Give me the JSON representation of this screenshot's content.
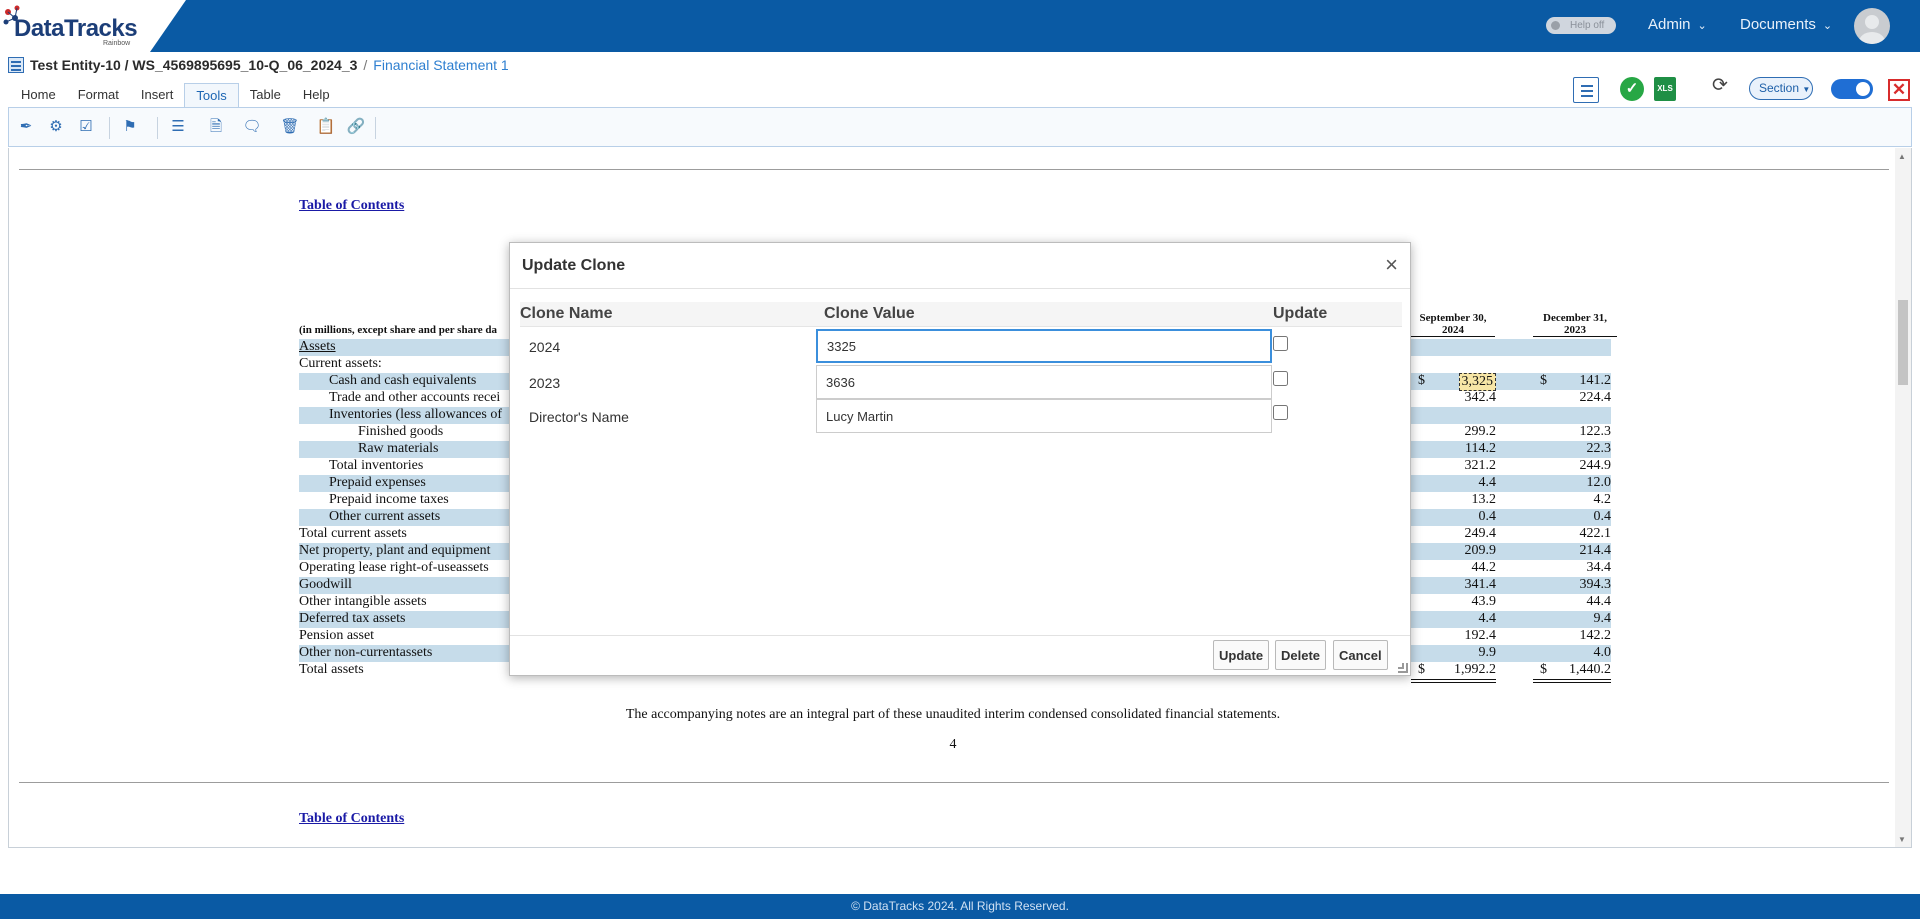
{
  "brand": {
    "logo_main": "DataTracks",
    "logo_sub": "Rainbow"
  },
  "header": {
    "help_toggle": "Help off",
    "admin_label": "Admin",
    "documents_label": "Documents"
  },
  "breadcrumb": {
    "entity_path": "Test Entity-10 / WS_4569895695_10-Q_06_2024_3",
    "separator": "/",
    "current": "Financial Statement 1"
  },
  "menu": {
    "items": [
      "Home",
      "Format",
      "Insert",
      "Tools",
      "Table",
      "Help"
    ],
    "active": "Tools"
  },
  "right_tools": {
    "section_label": "Section"
  },
  "document": {
    "toc_label": "Table of Contents",
    "unit_note": "(in millions, except share and per share da",
    "col1_header_line1": "September 30,",
    "col1_header_line2": "2024",
    "col2_header_line1": "December 31,",
    "col2_header_line2": "2023",
    "rows": [
      {
        "label": "Assets",
        "v1": "",
        "v2": ""
      },
      {
        "label": "Current assets:",
        "v1": "",
        "v2": ""
      },
      {
        "label": "Cash and cash equivalents",
        "v1": "3,325",
        "v2": "141.2"
      },
      {
        "label": "Trade and other accounts recei",
        "v1": "342.4",
        "v2": "224.4"
      },
      {
        "label": "Inventories (less allowances of",
        "v1": "",
        "v2": ""
      },
      {
        "label": "Finished goods",
        "v1": "299.2",
        "v2": "122.3"
      },
      {
        "label": "Raw materials",
        "v1": "114.2",
        "v2": "22.3"
      },
      {
        "label": "Total inventories",
        "v1": "321.2",
        "v2": "244.9"
      },
      {
        "label": "Prepaid expenses",
        "v1": "4.4",
        "v2": "12.0"
      },
      {
        "label": "Prepaid income taxes",
        "v1": "13.2",
        "v2": "4.2"
      },
      {
        "label": "Other current assets",
        "v1": "0.4",
        "v2": "0.4"
      },
      {
        "label": "Total current assets",
        "v1": "249.4",
        "v2": "422.1"
      },
      {
        "label": "Net property, plant and equipment",
        "v1": "209.9",
        "v2": "214.4"
      },
      {
        "label": "Operating lease right-of-useassets",
        "v1": "44.2",
        "v2": "34.4"
      },
      {
        "label": "Goodwill",
        "v1": "341.4",
        "v2": "394.3"
      },
      {
        "label": "Other intangible assets",
        "v1": "43.9",
        "v2": "44.4"
      },
      {
        "label": "Deferred tax assets",
        "v1": "4.4",
        "v2": "9.4"
      },
      {
        "label": "Pension asset",
        "v1": "192.4",
        "v2": "142.2"
      },
      {
        "label": "Other non-currentassets",
        "v1": "9.9",
        "v2": "4.0"
      },
      {
        "label": "Total assets",
        "v1": "1,992.2",
        "v2": "1,440.2"
      }
    ],
    "currency_symbol": "$",
    "footnote": "The accompanying notes are an integral part of these unaudited interim condensed consolidated financial statements.",
    "page_number": "4"
  },
  "modal": {
    "title": "Update Clone",
    "close_symbol": "×",
    "col_name": "Clone Name",
    "col_value": "Clone Value",
    "col_update": "Update",
    "rows": [
      {
        "name": "2024",
        "value": "3325"
      },
      {
        "name": "2023",
        "value": "3636"
      },
      {
        "name": "Director's Name",
        "value": "Lucy Martin"
      }
    ],
    "btn_update": "Update",
    "btn_delete": "Delete",
    "btn_cancel": "Cancel"
  },
  "footer": {
    "copyright": "© DataTracks 2024. All Rights Reserved."
  }
}
